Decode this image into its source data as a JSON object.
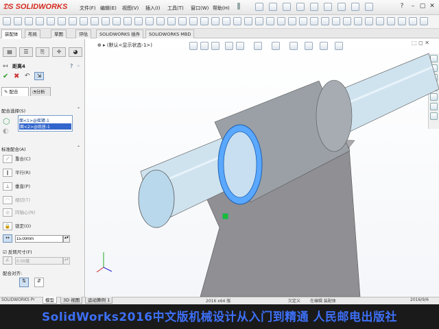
{
  "app": {
    "logo": "SOLIDWORKS",
    "menu": [
      "文件(F)",
      "编辑(E)",
      "视图(V)",
      "插入(I)",
      "工具(T)",
      "窗口(W)",
      "帮助(H)"
    ]
  },
  "command_tabs": [
    "装配体",
    "布局",
    "草图",
    "评估",
    "SOLIDWORKS 插件",
    "SOLIDWORKS MBD"
  ],
  "tree_path": "(默认<显示状态-1>)",
  "property_manager": {
    "title": "距离4",
    "tabs": [
      "配合",
      "分析"
    ],
    "selections": {
      "header": "配合选择(S)",
      "items": [
        "面<1>@摇臂-1",
        "面<2>@底座-1"
      ]
    },
    "standard": {
      "header": "标准配合(A)",
      "options": [
        {
          "label": "重合(C)",
          "enabled": true
        },
        {
          "label": "平行(R)",
          "enabled": true
        },
        {
          "label": "垂直(P)",
          "enabled": true
        },
        {
          "label": "相切(T)",
          "enabled": false
        },
        {
          "label": "同轴心(N)",
          "enabled": false
        },
        {
          "label": "锁定(O)",
          "enabled": true
        }
      ],
      "distance_value": "15.00mm",
      "flip_label": "反转尺寸(F)",
      "angle_value": "0.00度"
    },
    "alignment_label": "配合对齐:"
  },
  "status": {
    "tabs": [
      "模型",
      "3D 视图",
      "运动算例 1"
    ],
    "left_text": "SOLIDWORKS Pr",
    "middle_text": "2016 x64 版",
    "right_texts": [
      "欠定义",
      "在编辑 装配体",
      "2016/9/6"
    ]
  },
  "banner": "SolidWorks2016中文版机械设计从入门到精通 人民邮电出版社",
  "colors": {
    "banner_bg": "#1a1a1a",
    "banner_text": "#3d6ff5",
    "highlight": "#5aa8ff"
  }
}
